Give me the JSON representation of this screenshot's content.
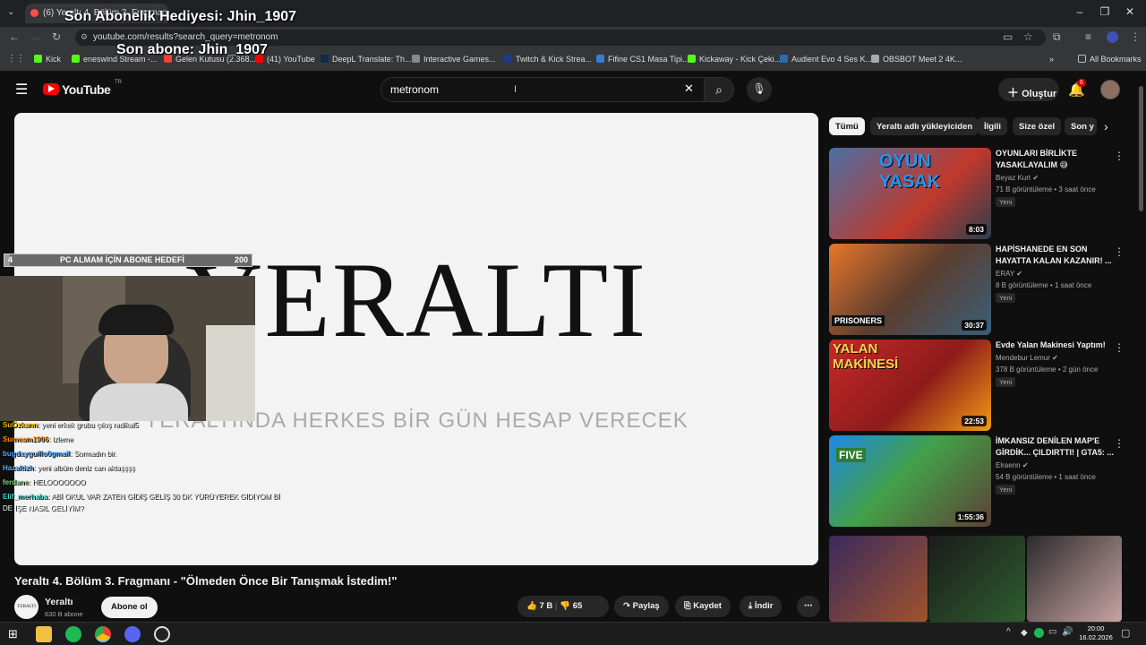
{
  "browser": {
    "tab_title": "(6) Yeraltı 4. Bölüm 3. Fragmanı",
    "url": "youtube.com/results?search_query=metronom",
    "bookmarks": [
      {
        "label": "Kick",
        "color": "#53fc18"
      },
      {
        "label": "eneswind Stream -...",
        "color": "#53fc18"
      },
      {
        "label": "Gelen Kutusu (2.368...",
        "color": "#ea4335"
      },
      {
        "label": "(41) YouTube",
        "color": "#ff0000"
      },
      {
        "label": "DeepL Translate: Th...",
        "color": "#0f2b46"
      },
      {
        "label": "Interactive Games...",
        "color": "#888888"
      },
      {
        "label": "Twitch & Kick Strea...",
        "color": "#1e3a8a"
      },
      {
        "label": "Fifine CS1 Masa Tipi...",
        "color": "#3a7bd5"
      },
      {
        "label": "Kickaway - Kick Çeki...",
        "color": "#53fc18"
      },
      {
        "label": "Audient Evo 4 Ses K...",
        "color": "#2b6cb0"
      },
      {
        "label": "OBSBOT Meet 2 4K...",
        "color": "#aaaaaa"
      }
    ],
    "all_bookmarks": "All Bookmarks"
  },
  "overlays": {
    "sub_gift": "Son Abonelik Hediyesi: Jhin_1907",
    "last_sub": "Son abone: Jhin_1907",
    "goal_label": "PC ALMAM İÇİN ABONE HEDEFİ",
    "goal_current": "4",
    "goal_target": "200",
    "goal_progress": 0.02
  },
  "chat": [
    {
      "user": "SuÖzkann",
      "msg": ": yeni erkek grubu çıkış radikal5",
      "color": "#e6b800"
    },
    {
      "user": "Sumeam1906",
      "msg": ": izleme",
      "color": "#ff8c00"
    },
    {
      "user": "bugdayguillo0gmail",
      "msg": ": Sormadın bir.",
      "color": "#4da6ff"
    },
    {
      "user": "Hazaltizh",
      "msg": ": yeni albüm deniz can aktaşşşş",
      "color": "#6fa8dc"
    },
    {
      "user": "ferdane",
      "msg": ": HELOOOOOOO",
      "color": "#7bd67b"
    },
    {
      "user": "Elif_merhaba",
      "msg": ": ABİ OKUL VAR ZATEN GİDİŞ GELİŞ 30 DK YÜRÜYEREK GİDİYOM Bİ",
      "color": "#4ecdc4"
    },
    {
      "user": "",
      "msg": "DE İŞE NASIL GELİYİM?",
      "color": "#ffffff"
    }
  ],
  "youtube": {
    "logo": "YouTube",
    "logo_region": "TR",
    "search_value": "metronom",
    "create_label": "Oluştur",
    "notif_count": "6"
  },
  "video": {
    "frame_title": "YERALTI",
    "frame_subtitle": "YERALTINDA HERKES BİR GÜN HESAP VERECEK",
    "title": "Yeraltı 4. Bölüm 3. Fragmanı - \"Ölmeden Önce Bir Tanışmak İstedim!\"",
    "channel": "Yeraltı",
    "subscribers": "630 B abone",
    "subscribe": "Abone ol",
    "likes": "7 B",
    "dislikes": "65",
    "share": "Paylaş",
    "save": "Kaydet",
    "download": "İndir"
  },
  "chips": [
    "Tümü",
    "Yeraltı adlı yükleyiciden",
    "İlgili",
    "Size özel",
    "Son y"
  ],
  "recommendations": [
    {
      "title": "OYUNLARI BİRLİKTE YASAKLAYALIM 😅",
      "channel": "Beyaz Kurt",
      "meta": "71 B görüntüleme • 3 saat önce",
      "badge": "Yeni",
      "duration": "8:03",
      "thumb_text": "OYUN YASAK"
    },
    {
      "title": "HAPİSHANEDE EN SON HAYATTA KALAN KAZANIR! ...",
      "channel": "ERAY",
      "meta": "8 B görüntüleme • 1 saat önce",
      "badge": "Yeni",
      "duration": "30:37",
      "thumb_text": "PRISONERS"
    },
    {
      "title": "Evde Yalan Makinesi Yaptım!",
      "channel": "Mendebur Lemur",
      "meta": "378 B görüntüleme • 2 gün önce",
      "badge": "Yeni",
      "duration": "22:53",
      "thumb_text": "YALAN MAKİNESİ"
    },
    {
      "title": "İMKANSIZ DENİLEN MAP'E GİRDİK... ÇILDIRTTI! | GTA5: ...",
      "channel": "Elraenn",
      "meta": "54 B görüntüleme • 1 saat önce",
      "badge": "Yeni",
      "duration": "1:55:36",
      "thumb_text": "FIVE"
    }
  ],
  "taskbar": {
    "time": "20:00",
    "date": "16.02.2026"
  }
}
